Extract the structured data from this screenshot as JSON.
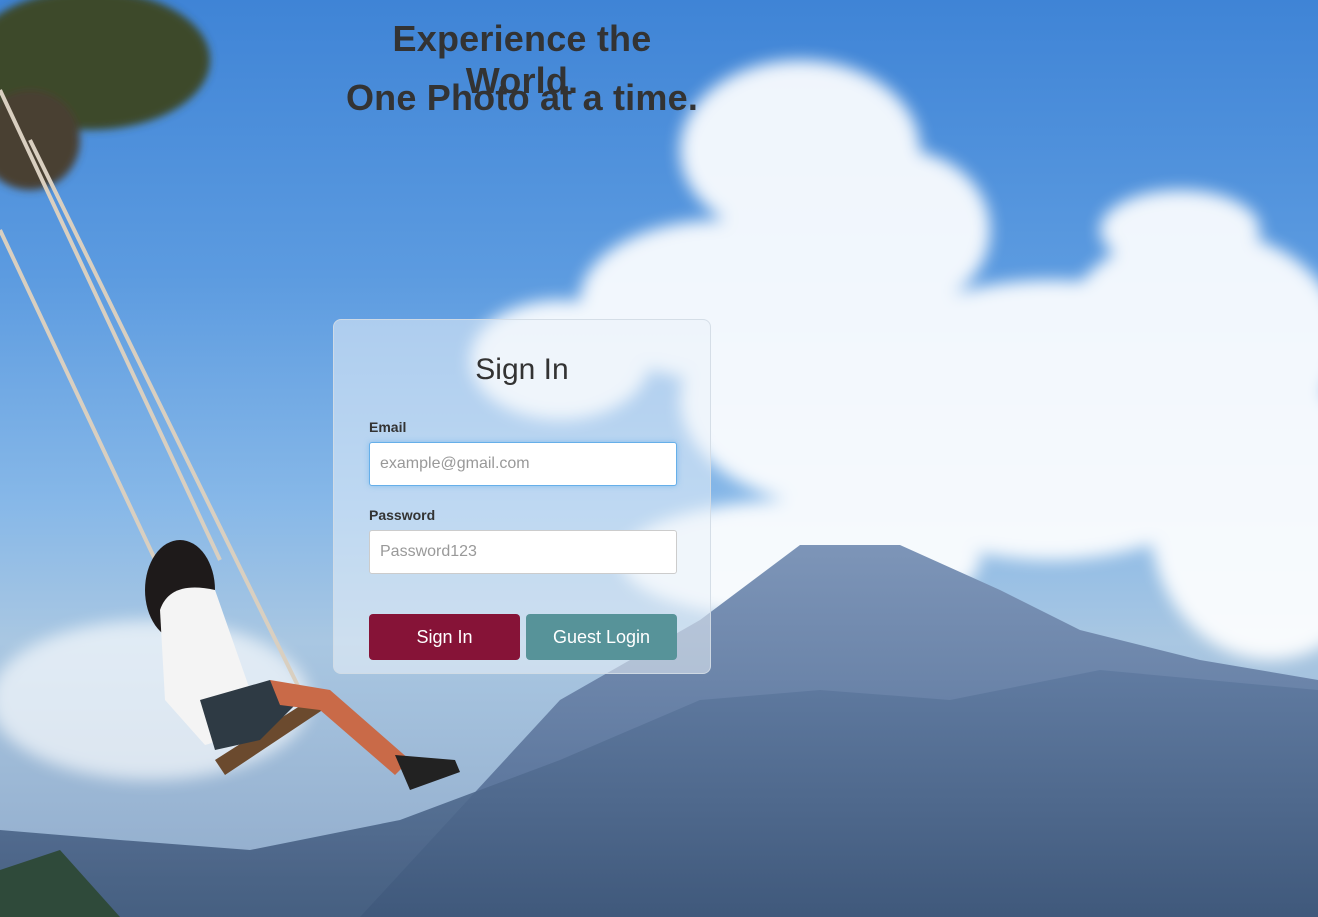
{
  "hero": {
    "line1": "Experience the World.",
    "line2": "One Photo at a time."
  },
  "signin_form": {
    "title": "Sign In",
    "email_label": "Email",
    "email_placeholder": "example@gmail.com",
    "email_value": "",
    "password_label": "Password",
    "password_placeholder": "Password123",
    "password_value": "",
    "signin_button": "Sign In",
    "guest_button": "Guest Login"
  },
  "colors": {
    "signin_button": "#861337",
    "guest_button": "#579399",
    "heading_text": "#333333"
  }
}
